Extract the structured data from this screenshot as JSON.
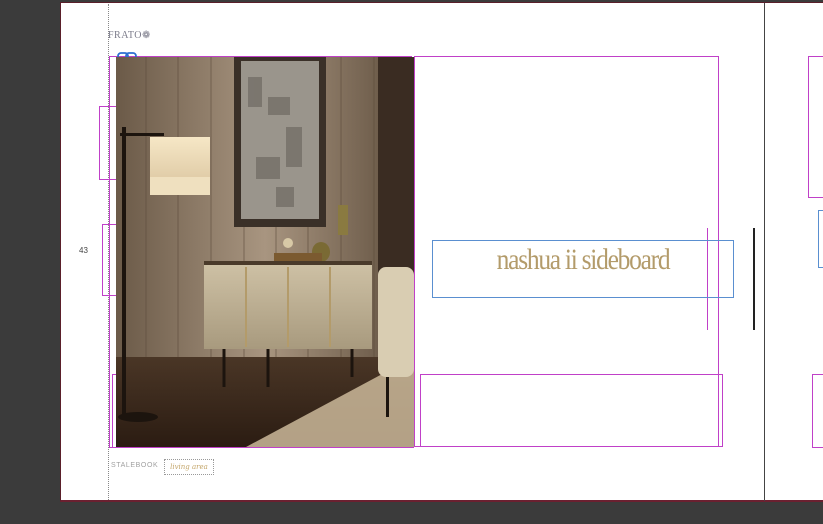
{
  "document": {
    "brand": "FRATO",
    "page_number": "43",
    "title": "nashua ii sideboard",
    "footer_left": "STALEBOOK",
    "footer_script": "living area"
  },
  "colors": {
    "pasteboard": "#3b3b3b",
    "frame_guide": "#c040c8",
    "text_frame": "#5a8fd0",
    "title_gold": "#b39b6a"
  },
  "icons": {
    "logo_mark": "flower-icon",
    "link": "link-icon"
  }
}
